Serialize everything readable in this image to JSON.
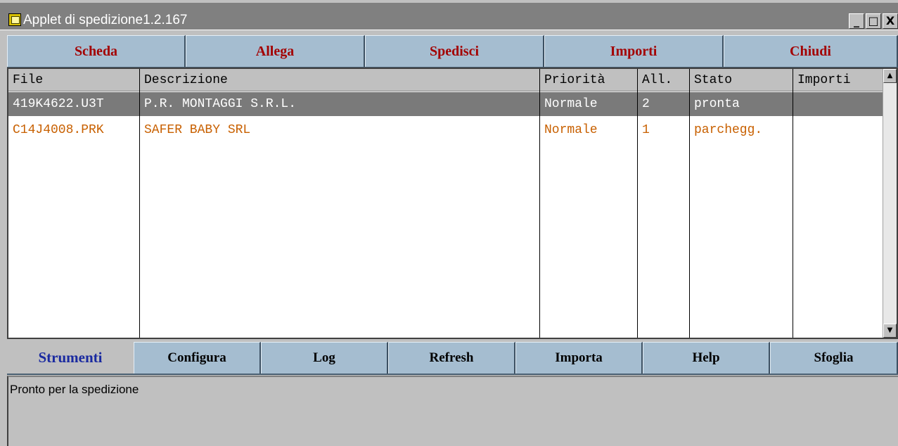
{
  "window": {
    "title": "Applet di spedizione1.2.167",
    "minimize_glyph": "_",
    "maximize_glyph": "□",
    "close_glyph": "X"
  },
  "toolbar_top": [
    {
      "label": "Scheda"
    },
    {
      "label": "Allega"
    },
    {
      "label": "Spedisci"
    },
    {
      "label": "Importi"
    },
    {
      "label": "Chiudi"
    }
  ],
  "table": {
    "columns": [
      "File",
      "Descrizione",
      "Priorità",
      "All.",
      "Stato",
      "Importi"
    ],
    "rows": [
      {
        "file": "419K4622.U3T",
        "descrizione": "P.R. MONTAGGI S.R.L.",
        "priorita": "Normale",
        "all": "2",
        "stato": "pronta",
        "importi": "",
        "selected": true
      },
      {
        "file": "C14J4008.PRK",
        "descrizione": "SAFER BABY SRL",
        "priorita": "Normale",
        "all": "1",
        "stato": "parchegg.",
        "importi": "",
        "selected": false
      }
    ]
  },
  "toolbar_bottom": {
    "section_label": "Strumenti",
    "buttons": [
      {
        "label": "Configura"
      },
      {
        "label": "Log"
      },
      {
        "label": "Refresh"
      },
      {
        "label": "Importa"
      },
      {
        "label": "Help"
      },
      {
        "label": "Sfoglia"
      }
    ]
  },
  "status": {
    "message": "Pronto per la spedizione"
  },
  "colors": {
    "toolbar_bg": "#a5bdd0",
    "toolbar_text": "#a30000",
    "section_label_text": "#1a2aa0",
    "selected_row_bg": "#7a7a7a",
    "parked_row_text": "#c86000"
  }
}
